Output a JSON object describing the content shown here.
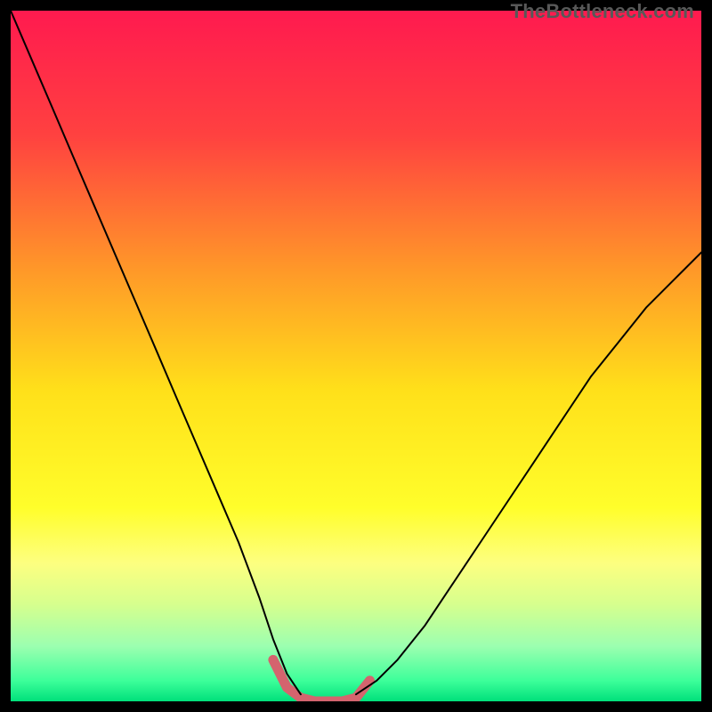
{
  "watermark": "TheBottleneck.com",
  "chart_data": {
    "type": "line",
    "title": "",
    "xlabel": "",
    "ylabel": "",
    "xlim": [
      0,
      100
    ],
    "ylim": [
      0,
      100
    ],
    "grid": false,
    "legend": false,
    "background": {
      "type": "vertical-gradient",
      "stops": [
        {
          "pos": 0.0,
          "color": "#ff1a4f"
        },
        {
          "pos": 0.18,
          "color": "#ff4140"
        },
        {
          "pos": 0.38,
          "color": "#ff9a28"
        },
        {
          "pos": 0.55,
          "color": "#ffe01a"
        },
        {
          "pos": 0.72,
          "color": "#fffe2b"
        },
        {
          "pos": 0.8,
          "color": "#fdff80"
        },
        {
          "pos": 0.86,
          "color": "#d6ff8e"
        },
        {
          "pos": 0.92,
          "color": "#9cffb0"
        },
        {
          "pos": 0.97,
          "color": "#3dff9a"
        },
        {
          "pos": 1.0,
          "color": "#00e07b"
        }
      ]
    },
    "series": [
      {
        "name": "curve-left",
        "color": "#000000",
        "width": 2,
        "x": [
          0,
          3,
          6,
          9,
          12,
          15,
          18,
          21,
          24,
          27,
          30,
          33,
          36,
          38,
          40,
          42
        ],
        "y": [
          100,
          93,
          86,
          79,
          72,
          65,
          58,
          51,
          44,
          37,
          30,
          23,
          15,
          9,
          4,
          1
        ]
      },
      {
        "name": "curve-right",
        "color": "#000000",
        "width": 2,
        "x": [
          50,
          53,
          56,
          60,
          64,
          68,
          72,
          76,
          80,
          84,
          88,
          92,
          96,
          100
        ],
        "y": [
          1,
          3,
          6,
          11,
          17,
          23,
          29,
          35,
          41,
          47,
          52,
          57,
          61,
          65
        ]
      },
      {
        "name": "trough-highlight",
        "color": "#d4646e",
        "width": 11,
        "x": [
          38,
          40,
          42,
          44,
          46,
          48,
          50,
          52
        ],
        "y": [
          6,
          2,
          0.5,
          0,
          0,
          0,
          0.5,
          3
        ]
      }
    ]
  }
}
